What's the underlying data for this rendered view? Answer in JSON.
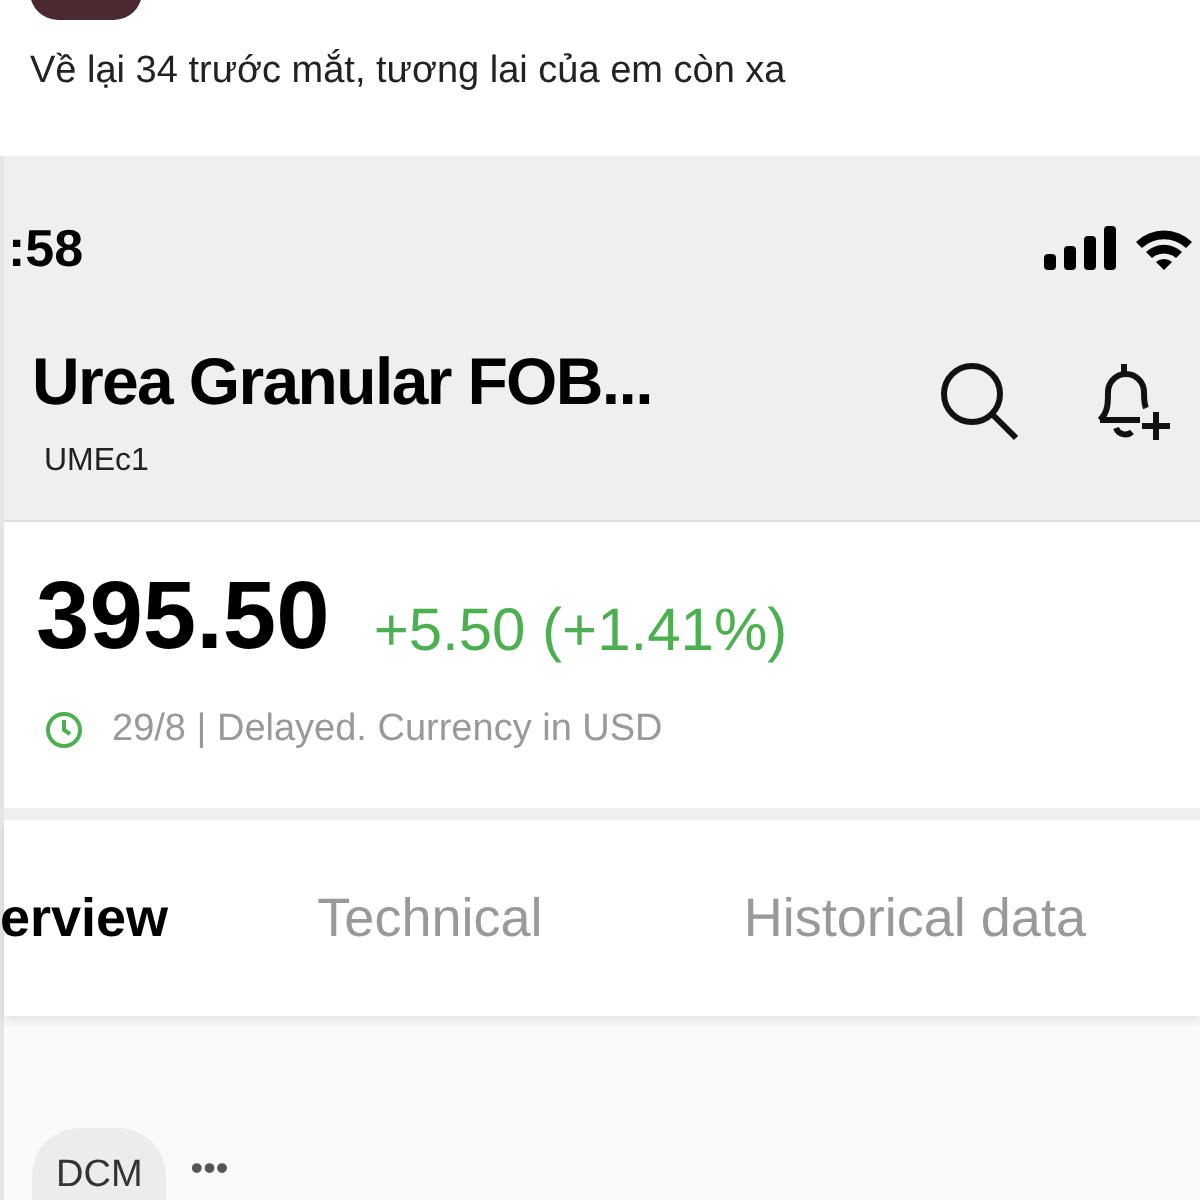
{
  "post": {
    "text": "Về lại 34 trước mắt, tương lai của em còn xa"
  },
  "phone": {
    "status_bar": {
      "time": ":58"
    },
    "header": {
      "title": "Urea Granular FOB...",
      "symbol": "UMEc1"
    },
    "quote": {
      "price": "395.50",
      "change": "+5.50 (+1.41%)",
      "info": "29/8 | Delayed. Currency in USD"
    },
    "tabs": [
      {
        "label": "erview",
        "selected": true
      },
      {
        "label": "Technical",
        "selected": false
      },
      {
        "label": "Historical data",
        "selected": false
      }
    ],
    "chips": [
      {
        "label": "DCM"
      }
    ],
    "more": "•••"
  }
}
